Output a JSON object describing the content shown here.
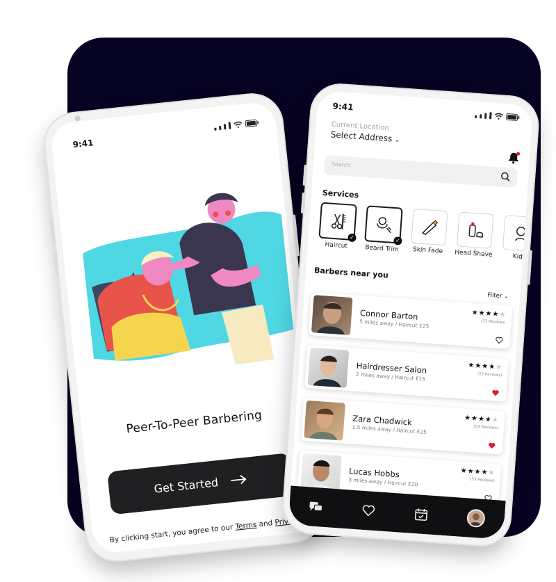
{
  "colors": {
    "panel": "#070322",
    "cta": "#202022",
    "accent_red": "#e4182a",
    "illustration_cyan": "#4fd7e3",
    "skin_pink": "#f088c4"
  },
  "left_phone": {
    "time": "9:41",
    "headline": "Peer-To-Peer Barbering",
    "cta_label": "Get Started",
    "cta_icon": "arrow-right-icon",
    "terms_prefix": "By clicking start, you agree to our",
    "terms_link": "Terms",
    "terms_and": "and",
    "privacy_link": "Privacy"
  },
  "right_phone": {
    "time": "9:41",
    "location_label": "Current Location",
    "location_value": "Select Address",
    "search_placeholder": "Search",
    "services_title": "Services",
    "services": [
      {
        "label": "Haircut",
        "icon": "scissors-comb-icon",
        "selected": true
      },
      {
        "label": "Beard Trim",
        "icon": "beard-trim-icon",
        "selected": true
      },
      {
        "label": "Skin Fade",
        "icon": "clipper-icon",
        "selected": false
      },
      {
        "label": "Head Shave",
        "icon": "shave-kit-icon",
        "selected": false
      },
      {
        "label": "Kids",
        "icon": "kids-icon",
        "selected": false
      }
    ],
    "barbers_title": "Barbers near you",
    "filter_label": "Filter",
    "barbers": [
      {
        "name": "Connor Barton",
        "meta": "5 miles away / Haircut £25",
        "rating": 4,
        "reviews": "(53 Reviews)",
        "favorite": false
      },
      {
        "name": "Hairdresser Salon",
        "meta": "2 miles away / Haircut £15",
        "rating": 4,
        "reviews": "(53 Reviews)",
        "favorite": true
      },
      {
        "name": "Zara Chadwick",
        "meta": "1.5 miles away / Haircut £25",
        "rating": 4,
        "reviews": "(53 Reviews)",
        "favorite": true
      },
      {
        "name": "Lucas Hobbs",
        "meta": "3 miles away / Haircut £20",
        "rating": 4,
        "reviews": "(53 Reviews)",
        "favorite": false
      }
    ],
    "nav": [
      "chat-icon",
      "heart-icon",
      "calendar-check-icon",
      "profile-avatar"
    ]
  }
}
